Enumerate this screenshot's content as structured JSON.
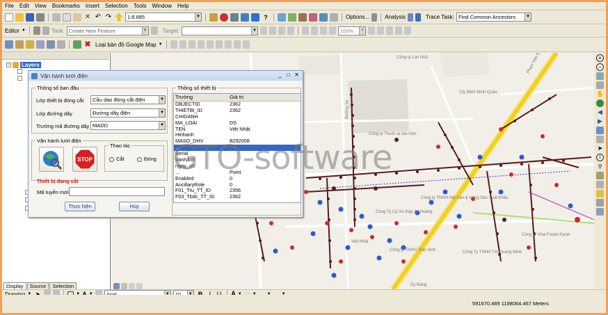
{
  "menu": [
    "File",
    "Edit",
    "View",
    "Bookmarks",
    "Insert",
    "Selection",
    "Tools",
    "Window",
    "Help"
  ],
  "toolbar": {
    "scale": "1:8.685",
    "options_label": "Options...",
    "analysis_label": "Analysis",
    "trace_task_label": "Trace Task:",
    "trace_task_value": "Find Common Ancestors"
  },
  "editor": {
    "editor_label": "Editor",
    "task_label": "Task:",
    "task_value": "Create New Feature",
    "target_label": "Target:",
    "target_value": "",
    "zoom_value": "100%"
  },
  "google": {
    "basemap_label": "Loại bản đồ Google Map"
  },
  "toc": {
    "layers_label": "Layers",
    "tabs": [
      "Display",
      "Source",
      "Selection"
    ]
  },
  "dialog": {
    "title": "Vận hành lưới điện",
    "group_initial": "Thông số ban đầu",
    "switch_layer_label": "Lớp thiết bị đóng cắt",
    "switch_layer_value": "Cầu dao đóng cắt điện",
    "line_layer_label": "Lớp đường dây",
    "line_layer_value": "Đường dây điện",
    "line_code_label": "Trường mã đường dây",
    "line_code_value": "MADD",
    "group_operate": "Vận hành lưới điện",
    "group_action": "Thao tác",
    "radio_cut": "Cắt",
    "radio_close": "Đóng",
    "device_status": "Thiết bị đang cắt",
    "new_route_label": "Mã tuyến mới",
    "execute_button": "Thực hiện",
    "cancel_button": "Hủy",
    "group_device": "Thông số thiết bị",
    "grid_headers": [
      "Trường",
      "Giá trị"
    ],
    "grid_rows": [
      [
        "OBJECTID",
        "2362"
      ],
      [
        "THIETBI_ID",
        "2362"
      ],
      [
        "CHIDANH",
        ""
      ],
      [
        "MA_LOAI",
        "DS"
      ],
      [
        "TEN",
        "Việt Nhật"
      ],
      [
        "Hinhanh",
        ""
      ],
      [
        "MASO_DHV",
        "B292008"
      ],
      [
        "...",
        ""
      ],
      [
        "Serial",
        ""
      ],
      [
        "Vanhanh",
        ""
      ],
      [
        "ngay_vh",
        ""
      ],
      [
        "...",
        "Point"
      ],
      [
        "Enabled",
        "0"
      ],
      [
        "AncillaryRole",
        "0"
      ],
      [
        "F01_Tru_TT_ID",
        "2356"
      ],
      [
        "F03_Tbdc_TT_ID",
        "2362"
      ]
    ]
  },
  "map": {
    "watermark": "GTO-software",
    "labels": [
      "Công ty Lan Nhã",
      "Cty Minh Minh Quân",
      "Công ty Thuốc lá Sài Gòn",
      "Phạm Văn Đồng",
      "Bưởng 34",
      "Công ty TNHH Hải Sản & Nông Sản Xuất Khẩu",
      "Công ty Vina Foods Kyoei",
      "Việt Nhật",
      "Công Ty Cp Xe Đạp Xe Hoàng",
      "Công ty TNHH Trần Sinh",
      "Công Ty TNHH Tín Quang Minh",
      "Ủy Đảng"
    ]
  },
  "drawing": {
    "drawing_label": "Drawing",
    "font_name": "Arial",
    "font_size": "10",
    "bold": "B",
    "italic": "I",
    "underline": "U",
    "text_tool": "A"
  },
  "status": {
    "coords": "591670.489  1198064.467 Meters"
  },
  "colors": {
    "accent_orange": "#f3a055",
    "selection_blue": "#3169c6",
    "road_yellow": "#f0d020",
    "line_dark": "#5a1a1a",
    "node_red": "#d02828",
    "node_blue": "#2a5ad8"
  }
}
